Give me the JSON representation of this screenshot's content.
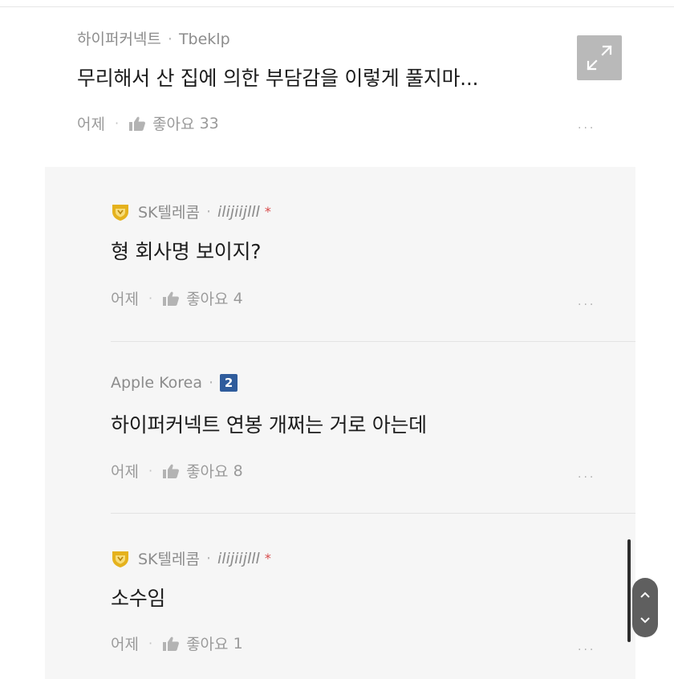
{
  "post": {
    "company": "하이퍼커넥트",
    "author": "Tbeklp",
    "title": "무리해서 산 집에 의한 부담감을 이렇게 풀지마...",
    "time": "어제",
    "like_label": "좋아요",
    "like_count": "33",
    "more": "..."
  },
  "replies": [
    {
      "company": "SK텔레콤",
      "author": "ilijiijlll",
      "badge": "shield",
      "text": "형 회사명 보이지?",
      "time": "어제",
      "like_label": "좋아요",
      "like_count": "4",
      "more": "..."
    },
    {
      "company": "Apple Korea",
      "author": "",
      "badge": "2",
      "text": "하이퍼커넥트 연봉 개쩌는 거로 아는데",
      "time": "어제",
      "like_label": "좋아요",
      "like_count": "8",
      "more": "..."
    },
    {
      "company": "SK텔레콤",
      "author": "ilijiijlll",
      "badge": "shield",
      "text": "소수임",
      "time": "어제",
      "like_label": "좋아요",
      "like_count": "1",
      "more": "..."
    }
  ],
  "colors": {
    "badge_blue": "#2f5c9c",
    "shield_gold": "#e5b21d",
    "star_red": "#d84a4a"
  },
  "icons": [
    "expand-icon",
    "thumbs-up-icon",
    "shield-badge-icon",
    "chevron-up-icon",
    "chevron-down-icon"
  ]
}
